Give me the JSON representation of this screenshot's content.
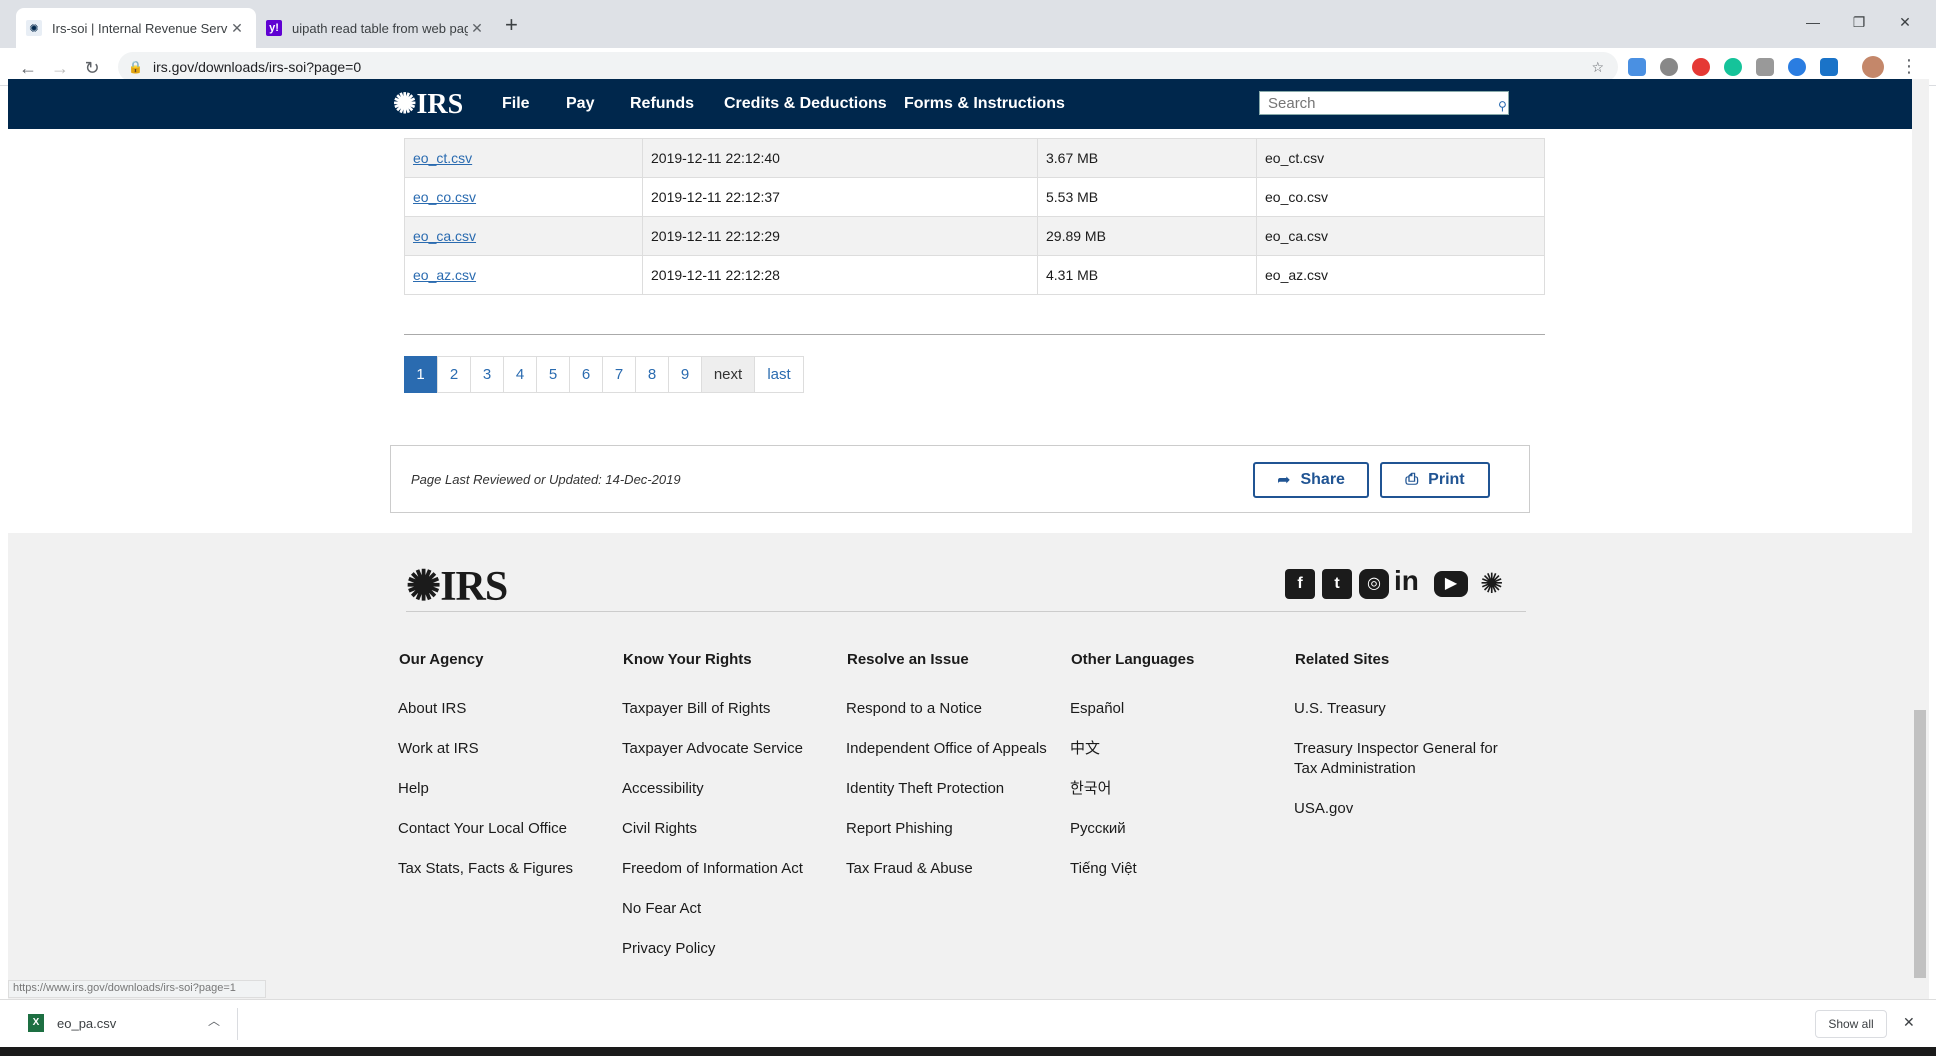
{
  "browser": {
    "tabs": [
      {
        "title": "Irs-soi | Internal Revenue Service"
      },
      {
        "title": "uipath read table from web page"
      }
    ],
    "url": "irs.gov/downloads/irs-soi?page=0",
    "status_url": "https://www.irs.gov/downloads/irs-soi?page=1"
  },
  "header": {
    "logo": "IRS",
    "nav": [
      "File",
      "Pay",
      "Refunds",
      "Credits & Deductions",
      "Forms & Instructions"
    ],
    "search_placeholder": "Search"
  },
  "table": {
    "rows": [
      {
        "file": "eo_ct.csv",
        "date": "2019-12-11 22:12:40",
        "size": "3.67 MB",
        "desc": "eo_ct.csv"
      },
      {
        "file": "eo_co.csv",
        "date": "2019-12-11 22:12:37",
        "size": "5.53 MB",
        "desc": "eo_co.csv"
      },
      {
        "file": "eo_ca.csv",
        "date": "2019-12-11 22:12:29",
        "size": "29.89 MB",
        "desc": "eo_ca.csv"
      },
      {
        "file": "eo_az.csv",
        "date": "2019-12-11 22:12:28",
        "size": "4.31 MB",
        "desc": "eo_az.csv"
      }
    ]
  },
  "pager": {
    "pages": [
      "1",
      "2",
      "3",
      "4",
      "5",
      "6",
      "7",
      "8",
      "9"
    ],
    "current": "1",
    "next": "next",
    "last": "last"
  },
  "review": {
    "text": "Page Last Reviewed or Updated: 14-Dec-2019",
    "share": "Share",
    "print": "Print"
  },
  "footer": {
    "logo": "IRS",
    "columns": [
      {
        "heading": "Our Agency",
        "links": [
          "About IRS",
          "Work at IRS",
          "Help",
          "Contact Your Local Office",
          "Tax Stats, Facts & Figures"
        ]
      },
      {
        "heading": "Know Your Rights",
        "links": [
          "Taxpayer Bill of Rights",
          "Taxpayer Advocate Service",
          "Accessibility",
          "Civil Rights",
          "Freedom of Information Act",
          "No Fear Act",
          "Privacy Policy"
        ]
      },
      {
        "heading": "Resolve an Issue",
        "links": [
          "Respond to a Notice",
          "Independent Office of Appeals",
          "Identity Theft Protection",
          "Report Phishing",
          "Tax Fraud & Abuse"
        ]
      },
      {
        "heading": "Other Languages",
        "links": [
          "Español",
          "中文",
          "한국어",
          "Русский",
          "Tiếng Việt"
        ]
      },
      {
        "heading": "Related Sites",
        "links": [
          "U.S. Treasury",
          "Treasury Inspector General for Tax Administration",
          "USA.gov"
        ]
      }
    ]
  },
  "downloads": {
    "file": "eo_pa.csv",
    "show_all": "Show all"
  },
  "colors": {
    "irs_navy": "#00274c",
    "link_blue": "#2a6bb0",
    "button_blue": "#205493"
  }
}
